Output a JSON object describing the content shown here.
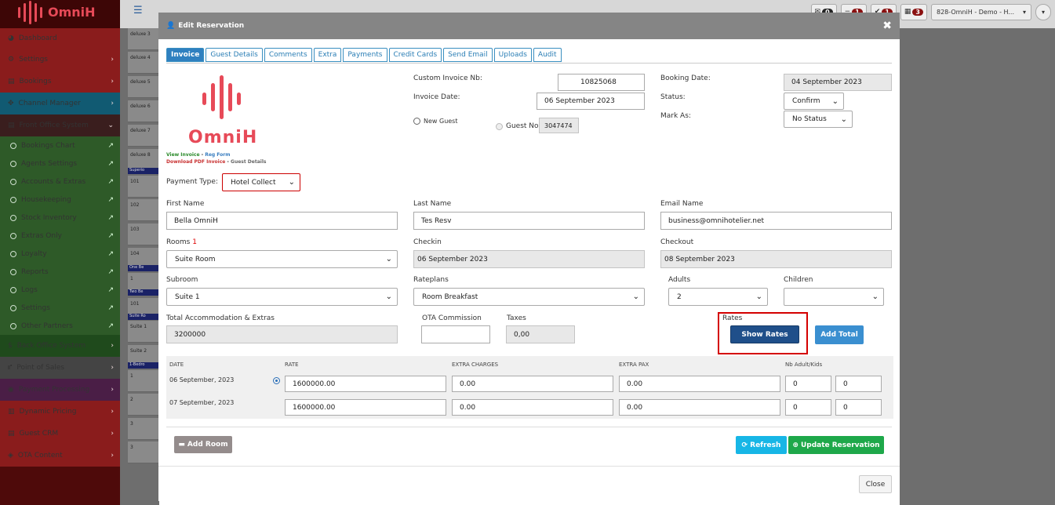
{
  "topbar": {
    "menu_icon": "hamburger-icon",
    "mail_count": "0",
    "minus_count": "1",
    "check_count": "1",
    "calendar_count": "3",
    "property": "828-OmniH - Demo - H..."
  },
  "sidebar": {
    "logo_text": "OmniH",
    "items": [
      {
        "label": "Dashboard"
      },
      {
        "label": "Settings"
      },
      {
        "label": "Bookings"
      },
      {
        "label": "Channel Manager"
      },
      {
        "label": "Front Office System"
      },
      {
        "label": "Bookings Chart"
      },
      {
        "label": "Agents Settings"
      },
      {
        "label": "Accounts & Extras"
      },
      {
        "label": "Housekeeping"
      },
      {
        "label": "Stock Inventory"
      },
      {
        "label": "Extras Only"
      },
      {
        "label": "Loyalty"
      },
      {
        "label": "Reports"
      },
      {
        "label": "Logs"
      },
      {
        "label": "Settings"
      },
      {
        "label": "Other Partners"
      },
      {
        "label": "Back Office System"
      },
      {
        "label": "Point of Sales"
      },
      {
        "label": "Payment Processing"
      },
      {
        "label": "Dynamic Pricing"
      },
      {
        "label": "Guest CRM"
      },
      {
        "label": "OTA Content"
      }
    ]
  },
  "background": {
    "rooms": [
      "deluxe 3",
      "deluxe 4",
      "deluxe 5",
      "deluxe 6",
      "deluxe 7",
      "deluxe 8",
      "101",
      "102",
      "103",
      "104",
      "1",
      "101",
      "Suite 1",
      "Suite 2",
      "1",
      "2",
      "3",
      "3"
    ],
    "headers": [
      "Superio",
      "One Be",
      "Two Be",
      "Suite Ro",
      "1-Bedro"
    ]
  },
  "modal": {
    "title": "Edit Reservation",
    "tabs": [
      "Invoice",
      "Guest Details",
      "Comments",
      "Extra",
      "Payments",
      "Credit Cards",
      "Send Email",
      "Uploads",
      "Audit"
    ],
    "logo_text": "OmniH",
    "link_view_invoice": "View Invoice",
    "link_reg_form": "Reg Form",
    "link_download_pdf": "Download PDF Invoice",
    "link_guest_details": "Guest Details",
    "link_sep": "-",
    "custom_invoice_label": "Custom Invoice Nb:",
    "custom_invoice_value": "10825068",
    "invoice_date_label": "Invoice Date:",
    "invoice_date_value": "06 September 2023",
    "new_guest_label": "New Guest",
    "guest_no_label": "Guest No",
    "guest_no_value": "3047474",
    "booking_date_label": "Booking Date:",
    "booking_date_value": "04 September 2023",
    "status_label": "Status:",
    "status_value": "Confirm",
    "mark_as_label": "Mark As:",
    "mark_as_value": "No Status",
    "payment_type_label": "Payment Type:",
    "payment_type_value": "Hotel Collect",
    "first_name_label": "First Name",
    "first_name_value": "Bella OmniH",
    "last_name_label": "Last Name",
    "last_name_value": "Tes Resv",
    "email_label": "Email Name",
    "email_value": "business@omnihotelier.net",
    "rooms_label": "Rooms",
    "rooms_required": "1",
    "rooms_value": "Suite Room",
    "checkin_label": "Checkin",
    "checkin_value": "06 September 2023",
    "checkout_label": "Checkout",
    "checkout_value": "08 September 2023",
    "subroom_label": "Subroom",
    "subroom_value": "Suite 1",
    "rateplans_label": "Rateplans",
    "rateplans_value": "Room Breakfast",
    "adults_label": "Adults",
    "adults_value": "2",
    "children_label": "Children",
    "children_value": "",
    "total_label": "Total Accommodation & Extras",
    "total_value": "3200000",
    "ota_label": "OTA Commission",
    "ota_value": "",
    "taxes_label": "Taxes",
    "taxes_value": "0,00",
    "rates_label": "Rates",
    "show_rates_button": "Show Rates",
    "add_total_button": "Add Total",
    "table_headers": [
      "DATE",
      "RATE",
      "EXTRA CHARGES",
      "EXTRA PAX",
      "Nb Adult/Kids"
    ],
    "rows": [
      {
        "date": "06 September, 2023",
        "rate": "1600000.00",
        "extra_charges": "0.00",
        "extra_pax": "0.00",
        "adults": "0",
        "kids": "0"
      },
      {
        "date": "07 September, 2023",
        "rate": "1600000.00",
        "extra_charges": "0.00",
        "extra_pax": "0.00",
        "adults": "0",
        "kids": "0"
      }
    ],
    "add_room_button": "Add Room",
    "refresh_button": "Refresh",
    "update_button": "Update Reservation",
    "close_button": "Close"
  },
  "colors": {
    "brand": "#e74a58",
    "primary": "#2f80c0",
    "show_rates": "#1f4f8a",
    "refresh": "#17b6e6",
    "update": "#1ea84a",
    "highlight": "#d40000"
  }
}
